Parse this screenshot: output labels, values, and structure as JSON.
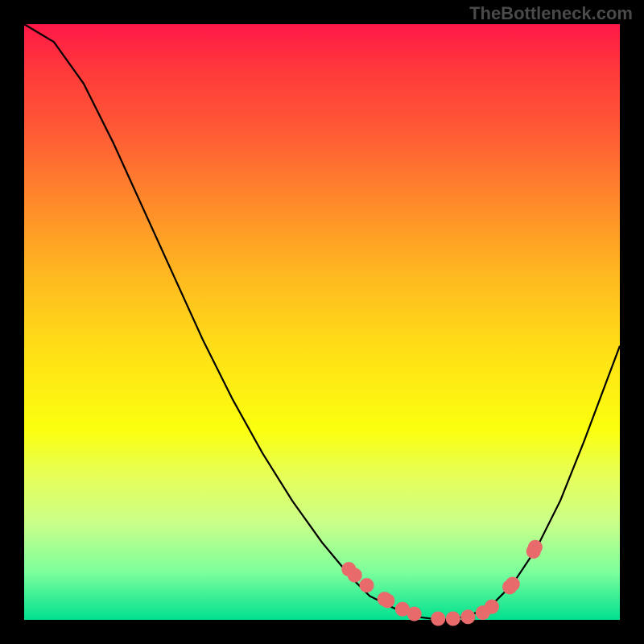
{
  "watermark": "TheBottleneck.com",
  "chart_data": {
    "type": "line",
    "title": "",
    "xlabel": "",
    "ylabel": "",
    "xlim": [
      0,
      1
    ],
    "ylim": [
      0,
      1
    ],
    "series": [
      {
        "name": "curve",
        "x": [
          0.0,
          0.05,
          0.1,
          0.15,
          0.2,
          0.25,
          0.3,
          0.35,
          0.4,
          0.45,
          0.5,
          0.55,
          0.58,
          0.62,
          0.66,
          0.7,
          0.74,
          0.78,
          0.82,
          0.86,
          0.9,
          0.94,
          1.0
        ],
        "y": [
          1.0,
          0.97,
          0.9,
          0.8,
          0.69,
          0.58,
          0.47,
          0.37,
          0.28,
          0.2,
          0.13,
          0.07,
          0.04,
          0.02,
          0.005,
          0.0,
          0.005,
          0.02,
          0.06,
          0.12,
          0.2,
          0.3,
          0.46
        ]
      }
    ],
    "markers": {
      "name": "points",
      "x": [
        0.545,
        0.555,
        0.575,
        0.605,
        0.61,
        0.635,
        0.655,
        0.695,
        0.72,
        0.745,
        0.77,
        0.785,
        0.815,
        0.82,
        0.855,
        0.858
      ],
      "y": [
        0.085,
        0.075,
        0.058,
        0.035,
        0.032,
        0.018,
        0.01,
        0.002,
        0.002,
        0.005,
        0.012,
        0.022,
        0.055,
        0.06,
        0.115,
        0.122
      ]
    },
    "gradient_stops": [
      {
        "pos": 0.0,
        "color": "#ff1848"
      },
      {
        "pos": 0.5,
        "color": "#ffe016"
      },
      {
        "pos": 1.0,
        "color": "#00e090"
      }
    ]
  }
}
